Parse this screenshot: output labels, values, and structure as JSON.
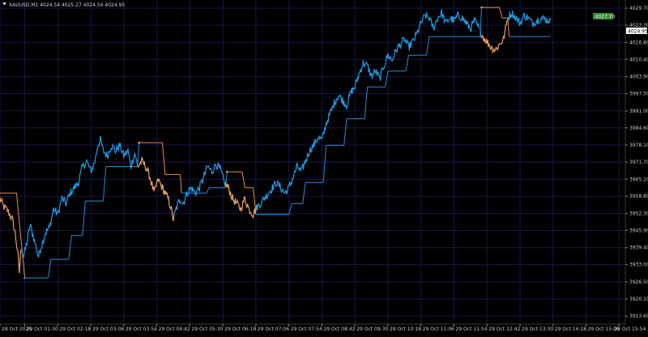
{
  "header": {
    "symbol_menu_icon": "triangle-down-icon",
    "symbol_info": "XAUUSD,M1  4024.54 4025.27 4024.54 4024.95"
  },
  "price_tags": {
    "upper_label": "4027.70",
    "current_label": "4024.95",
    "upper_color": "#3c8a3c",
    "current_color": "#ffffff"
  },
  "colors": {
    "background": "#000000",
    "grid": "#16164a",
    "bull_line": "#1e9ce8",
    "bear_line": "#e8a060",
    "stop_bull": "#1e90d8",
    "stop_bear": "#e09050",
    "axis_text": "#c8c8c8"
  },
  "chart_data": {
    "type": "line",
    "title": "",
    "xlabel": "",
    "ylabel": "",
    "ylim": [
      3910.6,
      4032.8
    ],
    "y_ticks": [
      4029.7,
      4023.3,
      4016.8,
      4010.4,
      4003.9,
      3997.5,
      3991.0,
      3984.6,
      3978.1,
      3971.7,
      3965.2,
      3958.8,
      3952.3,
      3945.9,
      3939.4,
      3933.0,
      3926.5,
      3920.1,
      3913.6
    ],
    "y_tick_labels": [
      "4029.70",
      "4023.30",
      "4016.80",
      "4010.40",
      "4003.90",
      "3997.50",
      "3991.00",
      "3984.60",
      "3978.10",
      "3971.70",
      "3965.20",
      "3958.80",
      "3952.30",
      "3945.90",
      "3939.40",
      "3933.00",
      "3926.50",
      "3920.10",
      "3913.60"
    ],
    "x_tick_labels": [
      "28 Oct 2025",
      "29 Oct 01:30",
      "29 Oct 02:18",
      "29 Oct 03:06",
      "29 Oct 03:54",
      "29 Oct 04:42",
      "29 Oct 05:30",
      "29 Oct 06:18",
      "29 Oct 07:06",
      "29 Oct 07:54",
      "29 Oct 08:42",
      "29 Oct 09:30",
      "29 Oct 10:18",
      "29 Oct 11:06",
      "29 Oct 11:54",
      "29 Oct 12:42",
      "29 Oct 13:30",
      "29 Oct 14:18",
      "29 Oct 15:06",
      "29 Oct 15:54"
    ],
    "x_tick_index": [
      0,
      36,
      84,
      132,
      180,
      228,
      276,
      324,
      372,
      420,
      468,
      516,
      564,
      612,
      660,
      708,
      756,
      804,
      852,
      900
    ],
    "n_points": 910,
    "price_anchors": [
      [
        0,
        3958
      ],
      [
        5,
        3955
      ],
      [
        12,
        3953
      ],
      [
        18,
        3950
      ],
      [
        22,
        3945
      ],
      [
        26,
        3937
      ],
      [
        28,
        3930
      ],
      [
        31,
        3940
      ],
      [
        34,
        3936
      ],
      [
        38,
        3940
      ],
      [
        44,
        3948
      ],
      [
        50,
        3942
      ],
      [
        56,
        3936
      ],
      [
        60,
        3940
      ],
      [
        66,
        3945
      ],
      [
        72,
        3947
      ],
      [
        78,
        3954
      ],
      [
        84,
        3952
      ],
      [
        90,
        3958
      ],
      [
        96,
        3956
      ],
      [
        102,
        3960
      ],
      [
        108,
        3962
      ],
      [
        114,
        3964
      ],
      [
        120,
        3970
      ],
      [
        126,
        3972
      ],
      [
        132,
        3968
      ],
      [
        138,
        3972
      ],
      [
        142,
        3978
      ],
      [
        146,
        3980
      ],
      [
        150,
        3976
      ],
      [
        156,
        3974
      ],
      [
        162,
        3978
      ],
      [
        168,
        3976
      ],
      [
        174,
        3978
      ],
      [
        180,
        3974
      ],
      [
        186,
        3976
      ],
      [
        190,
        3970
      ],
      [
        196,
        3975
      ],
      [
        200,
        3970
      ],
      [
        206,
        3972
      ],
      [
        212,
        3970
      ],
      [
        218,
        3966
      ],
      [
        224,
        3960
      ],
      [
        230,
        3965
      ],
      [
        236,
        3962
      ],
      [
        240,
        3960
      ],
      [
        244,
        3958
      ],
      [
        248,
        3955
      ],
      [
        252,
        3950
      ],
      [
        256,
        3954
      ],
      [
        262,
        3958
      ],
      [
        266,
        3956
      ],
      [
        272,
        3960
      ],
      [
        278,
        3962
      ],
      [
        284,
        3960
      ],
      [
        290,
        3962
      ],
      [
        296,
        3966
      ],
      [
        302,
        3970
      ],
      [
        308,
        3968
      ],
      [
        314,
        3971
      ],
      [
        320,
        3969
      ],
      [
        326,
        3964
      ],
      [
        332,
        3962
      ],
      [
        338,
        3958
      ],
      [
        344,
        3956
      ],
      [
        350,
        3954
      ],
      [
        356,
        3958
      ],
      [
        362,
        3954
      ],
      [
        368,
        3952
      ],
      [
        372,
        3954
      ],
      [
        378,
        3956
      ],
      [
        384,
        3958
      ],
      [
        390,
        3960
      ],
      [
        396,
        3962
      ],
      [
        402,
        3964
      ],
      [
        408,
        3962
      ],
      [
        414,
        3960
      ],
      [
        420,
        3962
      ],
      [
        426,
        3966
      ],
      [
        432,
        3970
      ],
      [
        438,
        3968
      ],
      [
        444,
        3972
      ],
      [
        450,
        3976
      ],
      [
        456,
        3978
      ],
      [
        462,
        3981
      ],
      [
        468,
        3980
      ],
      [
        474,
        3986
      ],
      [
        480,
        3990
      ],
      [
        486,
        3994
      ],
      [
        492,
        3997
      ],
      [
        498,
        3995
      ],
      [
        504,
        3993
      ],
      [
        510,
        3998
      ],
      [
        516,
        4000
      ],
      [
        522,
        4005
      ],
      [
        528,
        4009
      ],
      [
        534,
        4008
      ],
      [
        540,
        4004
      ],
      [
        546,
        4006
      ],
      [
        552,
        4003
      ],
      [
        558,
        4008
      ],
      [
        564,
        4012
      ],
      [
        570,
        4010
      ],
      [
        576,
        4014
      ],
      [
        582,
        4016
      ],
      [
        588,
        4018
      ],
      [
        594,
        4015
      ],
      [
        600,
        4017
      ],
      [
        606,
        4020
      ],
      [
        612,
        4024
      ],
      [
        618,
        4027
      ],
      [
        624,
        4026
      ],
      [
        630,
        4022
      ],
      [
        636,
        4026
      ],
      [
        642,
        4028
      ],
      [
        648,
        4024
      ],
      [
        654,
        4026
      ],
      [
        660,
        4025
      ],
      [
        666,
        4027
      ],
      [
        672,
        4026
      ],
      [
        678,
        4024
      ],
      [
        684,
        4022
      ],
      [
        690,
        4025
      ],
      [
        696,
        4022
      ],
      [
        702,
        4019
      ],
      [
        708,
        4017
      ],
      [
        714,
        4015
      ],
      [
        720,
        4014
      ],
      [
        726,
        4016
      ],
      [
        732,
        4018
      ],
      [
        738,
        4026
      ],
      [
        744,
        4028
      ],
      [
        750,
        4026
      ],
      [
        756,
        4024
      ],
      [
        762,
        4027
      ],
      [
        768,
        4026
      ],
      [
        774,
        4024
      ],
      [
        780,
        4025
      ],
      [
        786,
        4026
      ],
      [
        800,
        4025
      ]
    ],
    "bear_ranges": [
      [
        0,
        30
      ],
      [
        200,
        252
      ],
      [
        328,
        372
      ],
      [
        700,
        738
      ]
    ],
    "stop_anchors": [
      [
        0,
        3960,
        "bear"
      ],
      [
        24,
        3960,
        "bear"
      ],
      [
        36,
        3928,
        "bull"
      ],
      [
        70,
        3928,
        "bull"
      ],
      [
        74,
        3935,
        "bull"
      ],
      [
        100,
        3935,
        "bull"
      ],
      [
        104,
        3944,
        "bull"
      ],
      [
        120,
        3944,
        "bull"
      ],
      [
        124,
        3957,
        "bull"
      ],
      [
        150,
        3957,
        "bull"
      ],
      [
        154,
        3970,
        "bull"
      ],
      [
        200,
        3970,
        "bull"
      ],
      [
        202,
        3979,
        "bear"
      ],
      [
        236,
        3979,
        "bear"
      ],
      [
        240,
        3967,
        "bear"
      ],
      [
        262,
        3967,
        "bear"
      ],
      [
        264,
        3960,
        "bull"
      ],
      [
        300,
        3960,
        "bull"
      ],
      [
        304,
        3962,
        "bull"
      ],
      [
        328,
        3962,
        "bull"
      ],
      [
        330,
        3968,
        "bear"
      ],
      [
        352,
        3968,
        "bear"
      ],
      [
        356,
        3962,
        "bear"
      ],
      [
        368,
        3962,
        "bear"
      ],
      [
        372,
        3952,
        "bull"
      ],
      [
        420,
        3952,
        "bull"
      ],
      [
        424,
        3956,
        "bull"
      ],
      [
        440,
        3956,
        "bull"
      ],
      [
        444,
        3964,
        "bull"
      ],
      [
        470,
        3964,
        "bull"
      ],
      [
        474,
        3978,
        "bull"
      ],
      [
        500,
        3978,
        "bull"
      ],
      [
        504,
        3988,
        "bull"
      ],
      [
        530,
        3988,
        "bull"
      ],
      [
        534,
        4000,
        "bull"
      ],
      [
        560,
        4000,
        "bull"
      ],
      [
        564,
        4006,
        "bull"
      ],
      [
        590,
        4006,
        "bull"
      ],
      [
        594,
        4012,
        "bull"
      ],
      [
        620,
        4012,
        "bull"
      ],
      [
        624,
        4019,
        "bull"
      ],
      [
        698,
        4019,
        "bull"
      ],
      [
        700,
        4030,
        "bear"
      ],
      [
        726,
        4030,
        "bear"
      ],
      [
        730,
        4026,
        "bear"
      ],
      [
        738,
        4026,
        "bear"
      ],
      [
        740,
        4019,
        "bull"
      ],
      [
        800,
        4019,
        "bull"
      ]
    ]
  }
}
